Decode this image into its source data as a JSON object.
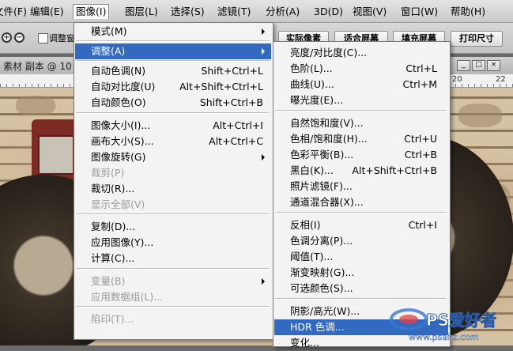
{
  "menubar": {
    "items": [
      {
        "label": "文件(F)"
      },
      {
        "label": "编辑(E)"
      },
      {
        "label": "图像(I)"
      },
      {
        "label": "图层(L)"
      },
      {
        "label": "选择(S)"
      },
      {
        "label": "滤镜(T)"
      },
      {
        "label": "分析(A)"
      },
      {
        "label": "3D(D)"
      },
      {
        "label": "视图(V)"
      },
      {
        "label": "窗口(W)"
      },
      {
        "label": "帮助(H)"
      }
    ]
  },
  "options": {
    "resize_window_label": "调整窗",
    "buttons": [
      "实际像素",
      "适合屏幕",
      "填充屏幕",
      "打印尺寸"
    ],
    "zoom_in_icon": "zoom-in-icon",
    "zoom_out_icon": "zoom-out-icon"
  },
  "document": {
    "title": "素材 副本 @ 10",
    "ruler_numbers": [
      "20",
      "22"
    ]
  },
  "image_menu": {
    "items": [
      {
        "label": "模式(M)",
        "shortcut": "",
        "submenu": true,
        "disabled": false
      },
      {
        "label": "调整(A)",
        "shortcut": "",
        "submenu": true,
        "disabled": false,
        "highlighted": true
      },
      {
        "label": "自动色调(N)",
        "shortcut": "Shift+Ctrl+L",
        "disabled": false
      },
      {
        "label": "自动对比度(U)",
        "shortcut": "Alt+Shift+Ctrl+L",
        "disabled": false
      },
      {
        "label": "自动颜色(O)",
        "shortcut": "Shift+Ctrl+B",
        "disabled": false
      },
      {
        "label": "图像大小(I)...",
        "shortcut": "Alt+Ctrl+I",
        "disabled": false
      },
      {
        "label": "画布大小(S)...",
        "shortcut": "Alt+Ctrl+C",
        "disabled": false
      },
      {
        "label": "图像旋转(G)",
        "shortcut": "",
        "submenu": true,
        "disabled": false
      },
      {
        "label": "裁剪(P)",
        "shortcut": "",
        "disabled": true
      },
      {
        "label": "裁切(R)...",
        "shortcut": "",
        "disabled": false
      },
      {
        "label": "显示全部(V)",
        "shortcut": "",
        "disabled": true
      },
      {
        "label": "复制(D)...",
        "shortcut": "",
        "disabled": false
      },
      {
        "label": "应用图像(Y)...",
        "shortcut": "",
        "disabled": false
      },
      {
        "label": "计算(C)...",
        "shortcut": "",
        "disabled": false
      },
      {
        "label": "变量(B)",
        "shortcut": "",
        "submenu": true,
        "disabled": true
      },
      {
        "label": "应用数据组(L)...",
        "shortcut": "",
        "disabled": true
      },
      {
        "label": "陷印(T)...",
        "shortcut": "",
        "disabled": true
      }
    ]
  },
  "adjust_menu": {
    "items": [
      {
        "label": "亮度/对比度(C)...",
        "shortcut": ""
      },
      {
        "label": "色阶(L)...",
        "shortcut": "Ctrl+L"
      },
      {
        "label": "曲线(U)...",
        "shortcut": "Ctrl+M"
      },
      {
        "label": "曝光度(E)...",
        "shortcut": ""
      },
      {
        "label": "自然饱和度(V)...",
        "shortcut": ""
      },
      {
        "label": "色相/饱和度(H)...",
        "shortcut": "Ctrl+U"
      },
      {
        "label": "色彩平衡(B)...",
        "shortcut": "Ctrl+B"
      },
      {
        "label": "黑白(K)...",
        "shortcut": "Alt+Shift+Ctrl+B"
      },
      {
        "label": "照片滤镜(F)...",
        "shortcut": ""
      },
      {
        "label": "通道混合器(X)...",
        "shortcut": ""
      },
      {
        "label": "反相(I)",
        "shortcut": "Ctrl+I"
      },
      {
        "label": "色调分离(P)...",
        "shortcut": ""
      },
      {
        "label": "阈值(T)...",
        "shortcut": ""
      },
      {
        "label": "渐变映射(G)...",
        "shortcut": ""
      },
      {
        "label": "可选颜色(S)...",
        "shortcut": ""
      },
      {
        "label": "阴影/高光(W)...",
        "shortcut": ""
      },
      {
        "label": "HDR 色调...",
        "shortcut": "",
        "highlighted": true
      },
      {
        "label": "变化...",
        "shortcut": ""
      }
    ]
  },
  "watermark": {
    "brand": "PS爱好者",
    "url": "www.psahz.com"
  },
  "colors": {
    "highlight": "#3269c1",
    "menu_bg": "#f3f3f3"
  }
}
